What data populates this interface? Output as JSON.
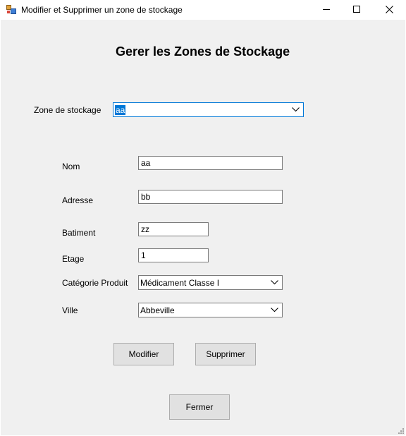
{
  "window": {
    "title": "Modifier et Supprimer un zone de stockage"
  },
  "form": {
    "heading": "Gerer les Zones de Stockage",
    "zone_label": "Zone de stockage",
    "zone_selected": "aa",
    "fields": {
      "nom_label": "Nom",
      "nom_value": "aa",
      "adresse_label": "Adresse",
      "adresse_value": "bb",
      "batiment_label": "Batiment",
      "batiment_value": "zz",
      "etage_label": "Etage",
      "etage_value": "1",
      "categorie_label": "Catégorie Produit",
      "categorie_value": "Médicament Classe I",
      "ville_label": "Ville",
      "ville_value": "Abbeville"
    },
    "buttons": {
      "modifier": "Modifier",
      "supprimer": "Supprimer",
      "fermer": "Fermer"
    }
  },
  "icons": {
    "app": "app-icon",
    "minimize": "minimize-icon",
    "maximize": "maximize-icon",
    "close": "close-icon",
    "dropdown": "chevron-down-icon",
    "resize": "resize-grip-icon"
  },
  "colors": {
    "client_bg": "#f0f0f0",
    "focus_border": "#0078d7",
    "selection": "#0078d7",
    "button_bg": "#e1e1e1"
  }
}
